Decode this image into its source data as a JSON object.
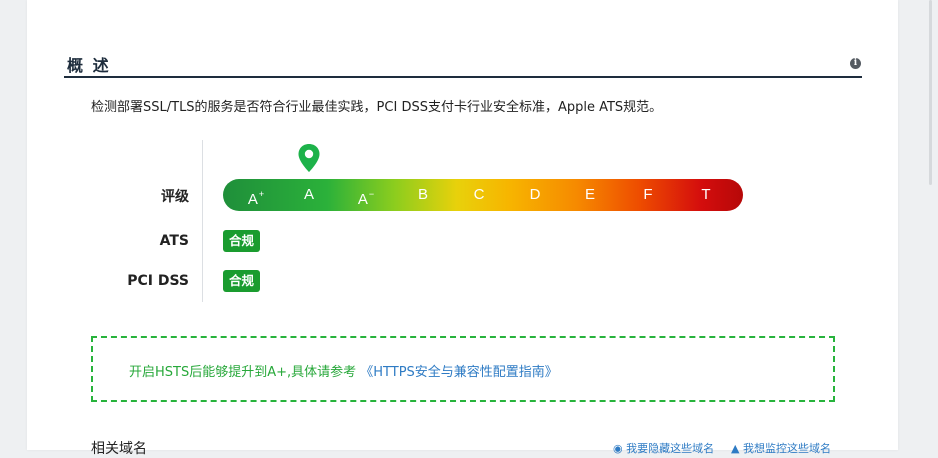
{
  "section": {
    "title": "概 述",
    "info_icon": "info-icon"
  },
  "description": "检测部署SSL/TLS的服务是否符合行业最佳实践，PCI DSS支付卡行业安全标准，Apple ATS规范。",
  "rating": {
    "label": "评级",
    "current": "A",
    "grades": [
      {
        "base": "A",
        "mod": "+"
      },
      {
        "base": "A",
        "mod": ""
      },
      {
        "base": "A",
        "mod": "−"
      },
      {
        "base": "B",
        "mod": ""
      },
      {
        "base": "C",
        "mod": ""
      },
      {
        "base": "D",
        "mod": ""
      },
      {
        "base": "E",
        "mod": ""
      },
      {
        "base": "F",
        "mod": ""
      },
      {
        "base": "T",
        "mod": ""
      }
    ],
    "marker_color": "#1db24a"
  },
  "ats": {
    "label": "ATS",
    "status": "合规"
  },
  "pci": {
    "label": "PCI DSS",
    "status": "合规"
  },
  "notice": {
    "text": "开启HSTS后能够提升到A+,具体请参考",
    "link": "《HTTPS安全与兼容性配置指南》"
  },
  "related": {
    "title": "相关域名",
    "hide_link": "我要隐藏这些域名",
    "monitor_link": "我想监控这些域名"
  },
  "colors": {
    "badge": "#1a9c2f",
    "notice_border": "#27b33c",
    "link": "#2e7bc4",
    "header_rule": "#1e2d3d"
  }
}
